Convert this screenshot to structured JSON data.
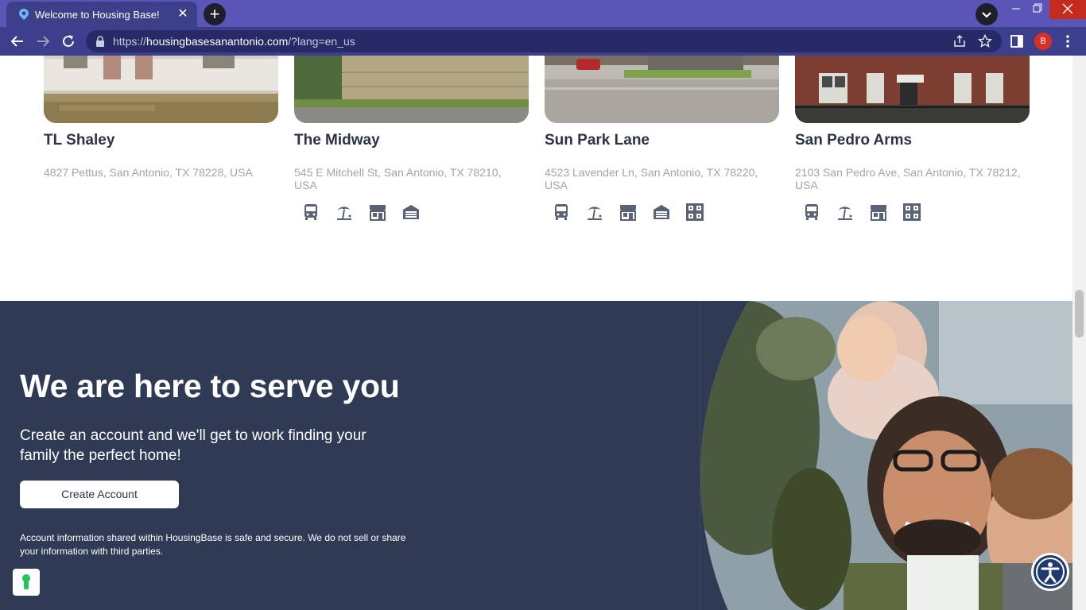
{
  "browser": {
    "tab_title": "Welcome to Housing Base!",
    "tab_close": "✕",
    "new_tab": "+",
    "url_scheme": "https://",
    "url_host": "housingbasesanantonio.com",
    "url_path": "/?lang=en_us",
    "profile_initial": "B",
    "accent": "#5b55b8"
  },
  "listings": [
    {
      "name": "TL Shaley",
      "address": "4827 Pettus, San Antonio, TX 78228, USA",
      "amenities": []
    },
    {
      "name": "The Midway",
      "address": "545 E Mitchell St, San Antonio, TX 78210, USA",
      "amenities": [
        "bus-icon",
        "beach-icon",
        "store-icon",
        "garage-icon"
      ]
    },
    {
      "name": "Sun Park Lane",
      "address": "4523 Lavender Ln, San Antonio, TX 78220, USA",
      "amenities": [
        "bus-icon",
        "beach-icon",
        "store-icon",
        "garage-icon",
        "building-icon"
      ]
    },
    {
      "name": "San Pedro Arms",
      "address": "2103 San Pedro Ave, San Antonio, TX 78212, USA",
      "amenities": [
        "bus-icon",
        "beach-icon",
        "store-icon",
        "building-icon"
      ]
    }
  ],
  "hero": {
    "title": "We are here to serve you",
    "subtitle": "Create an account and we'll get to work finding your family the perfect home!",
    "cta_label": "Create Account",
    "note": "Account information shared within HousingBase is safe and secure. We do not sell or share your information with third parties.",
    "background": "#2f3a55"
  }
}
